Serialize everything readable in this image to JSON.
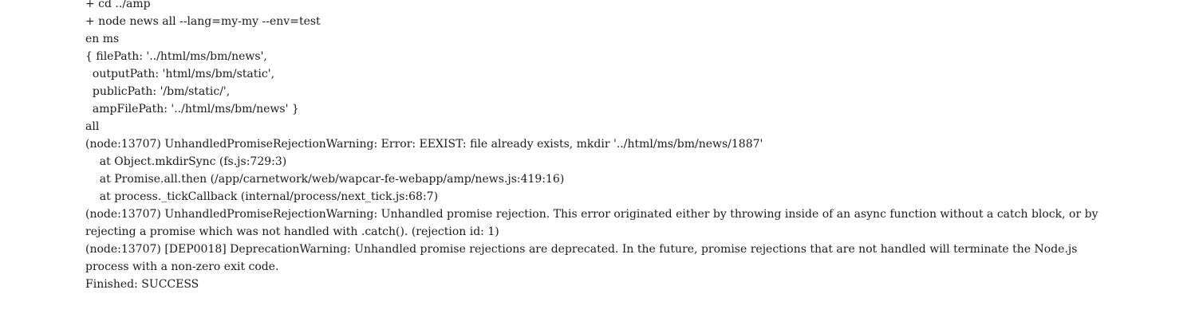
{
  "console": {
    "lines": [
      "+ cd ../amp",
      "+ node news all --lang=my-my --env=test",
      "en ms",
      "{ filePath: '../html/ms/bm/news',",
      "  outputPath: 'html/ms/bm/static',",
      "  publicPath: '/bm/static/',",
      "  ampFilePath: '../html/ms/bm/news' }",
      "all",
      "(node:13707) UnhandledPromiseRejectionWarning: Error: EEXIST: file already exists, mkdir '../html/ms/bm/news/1887'",
      "    at Object.mkdirSync (fs.js:729:3)",
      "    at Promise.all.then (/app/carnetwork/web/wapcar-fe-webapp/amp/news.js:419:16)",
      "    at process._tickCallback (internal/process/next_tick.js:68:7)",
      "(node:13707) UnhandledPromiseRejectionWarning: Unhandled promise rejection. This error originated either by throwing inside of an async function without a catch block, or by",
      "rejecting a promise which was not handled with .catch(). (rejection id: 1)",
      "(node:13707) [DEP0018] DeprecationWarning: Unhandled promise rejections are deprecated. In the future, promise rejections that are not handled will terminate the Node.js",
      "process with a non-zero exit code.",
      "Finished: SUCCESS"
    ]
  }
}
